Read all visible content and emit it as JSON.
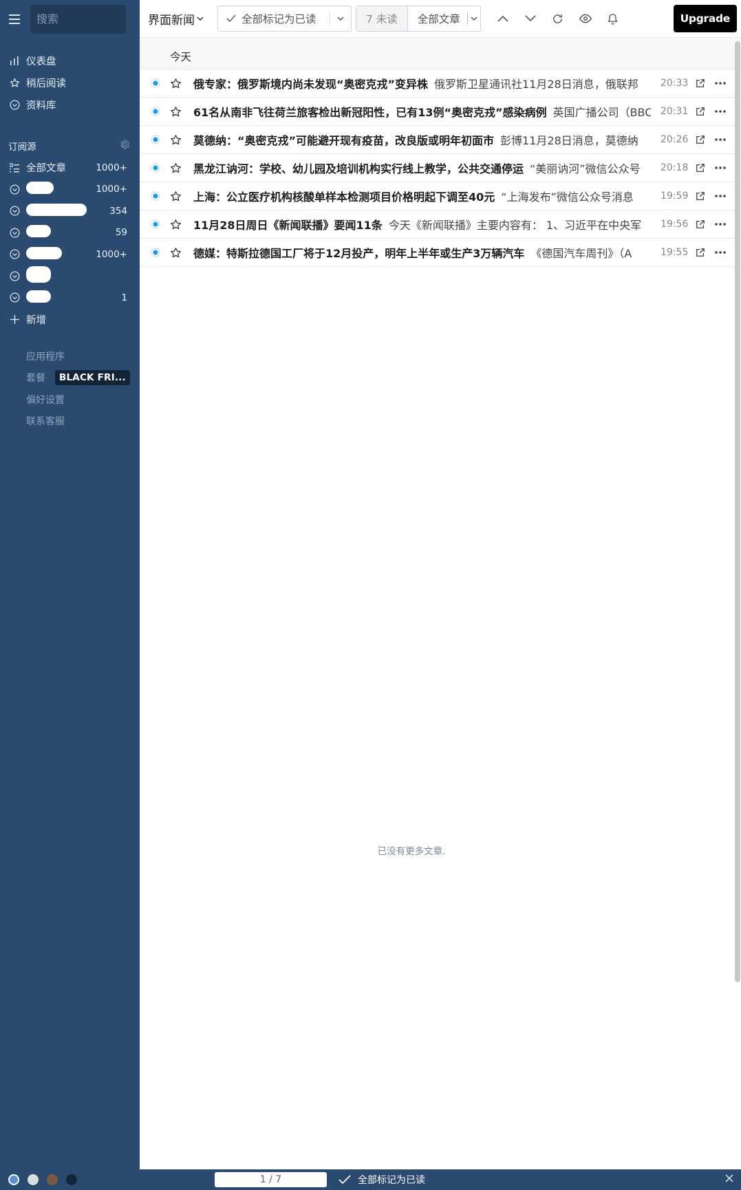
{
  "sidebar": {
    "search_placeholder": "搜索",
    "nav": [
      {
        "label": "仪表盘",
        "icon": "bar-chart-icon"
      },
      {
        "label": "稍后阅读",
        "icon": "star-icon"
      },
      {
        "label": "资料库",
        "icon": "circle-chevron-icon"
      }
    ],
    "subscriptions_label": "订阅源",
    "all_articles": {
      "label": "全部文章",
      "count": "1000+"
    },
    "feeds": [
      {
        "name": "",
        "count": "1000+"
      },
      {
        "name": "",
        "count": "354"
      },
      {
        "name": "",
        "count": "59"
      },
      {
        "name": "",
        "count": "1000+"
      },
      {
        "name": "",
        "count": ""
      },
      {
        "name": "",
        "count": "1"
      }
    ],
    "add_label": "新增",
    "secondary": [
      {
        "label": "应用程序"
      },
      {
        "label": "套餐",
        "badge": "BLACK FRI..."
      },
      {
        "label": "偏好设置"
      },
      {
        "label": "联系客服"
      }
    ]
  },
  "toolbar": {
    "feed_title": "界面新闻",
    "mark_all_read": "全部标记为已读",
    "unread_filter": "7 未读",
    "all_filter": "全部文章",
    "upgrade": "Upgrade"
  },
  "list": {
    "day_label": "今天",
    "articles": [
      {
        "title": "俄专家：俄罗斯境内尚未发现“奥密克戎”变异株",
        "snippet": "俄罗斯卫星通讯社11月28日消息，俄联邦",
        "time": "20:33"
      },
      {
        "title": "61名从南非飞往荷兰旅客检出新冠阳性，已有13例“奥密克戎”感染病例",
        "snippet": "英国广播公司（BBC）",
        "time": "20:31"
      },
      {
        "title": "莫德纳：“奥密克戎”可能避开现有疫苗，改良版或明年初面市",
        "snippet": "彭博11月28日消息，莫德纳",
        "time": "20:26"
      },
      {
        "title": "黑龙江讷河：学校、幼儿园及培训机构实行线上教学，公共交通停运",
        "snippet": "“美丽讷河”微信公众号",
        "time": "20:18"
      },
      {
        "title": "上海：公立医疗机构核酸单样本检测项目价格明起下调至40元",
        "snippet": "“上海发布”微信公众号消息",
        "time": "19:59"
      },
      {
        "title": "11月28日周日《新闻联播》要闻11条",
        "snippet": "今天《新闻联播》主要内容有： 1、习近平在中央军",
        "time": "19:56"
      },
      {
        "title": "德媒：特斯拉德国工厂将于12月投产，明年上半年或生产3万辆汽车",
        "snippet": "《德国汽车周刊》（A",
        "time": "19:55"
      }
    ],
    "empty_message": "已没有更多文章."
  },
  "bottombar": {
    "theme_colors": [
      "#5b8fd6",
      "#d9dde2",
      "#7a5a45",
      "#13253b"
    ],
    "page_indicator": "1 / 7",
    "mark_all_read": "全部标记为已读"
  },
  "colors": {
    "sidebar_bg": "#2b4a6f",
    "unread_dot": "#1e9be8",
    "upgrade_bg": "#000000"
  }
}
